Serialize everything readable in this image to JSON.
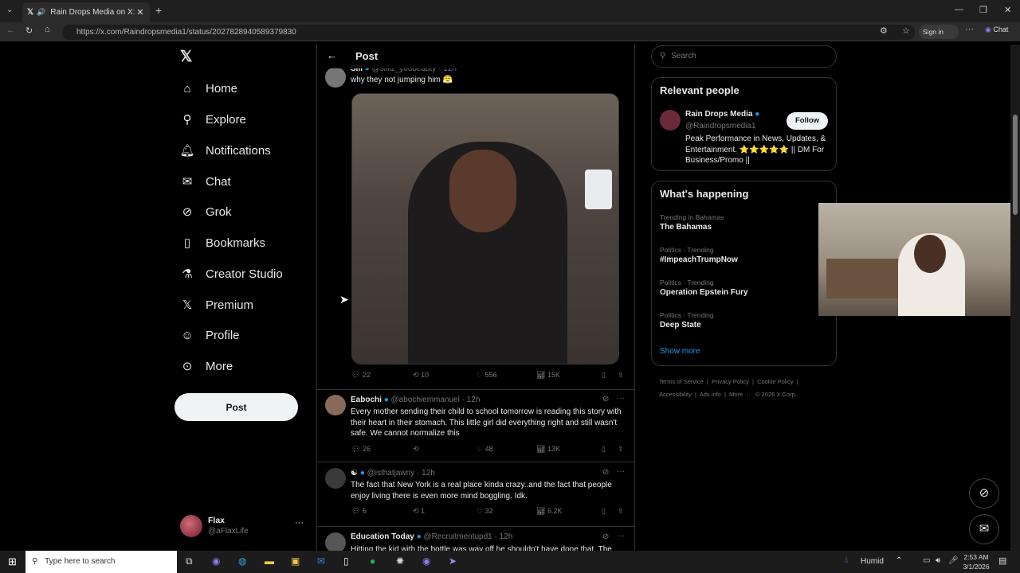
{
  "browser": {
    "tab_title": "Rain Drops Media on X: \"A m",
    "url": "https://x.com/Raindropsmedia1/status/2027828940589379830",
    "signin": "Sign in",
    "chat": "Chat"
  },
  "nav": {
    "items": [
      "Home",
      "Explore",
      "Notifications",
      "Chat",
      "Grok",
      "Bookmarks",
      "Creator Studio",
      "Premium",
      "Profile",
      "More"
    ],
    "post": "Post"
  },
  "account": {
    "name": "Flax",
    "handle": "@aFlaxLife"
  },
  "header": {
    "title": "Post"
  },
  "tweets": [
    {
      "name": "Sili",
      "handle": "@silliz_youbeauty",
      "time": "· 12h",
      "text": "why they not jumping him 😤",
      "replies": "22",
      "reposts": "10",
      "likes": "556",
      "views": "15K"
    },
    {
      "name": "Eabochi",
      "handle": "@abochiemmanuel",
      "time": "· 12h",
      "text": "Every mother sending their child to school tomorrow is reading this story with their heart in their stomach. This little girl did everything right and still wasn't safe. We cannot normalize this",
      "replies": "26",
      "reposts": "",
      "likes": "48",
      "views": "13K"
    },
    {
      "name": "",
      "handle": "@isthatjawny",
      "time": "· 12h",
      "text": "The fact that New York is a real place kinda crazy..and the fact that people enjoy living there is even more mind boggling. Idk.",
      "replies": "6",
      "reposts": "1",
      "likes": "32",
      "views": "6.2K"
    },
    {
      "name": "Education Today",
      "handle": "@Recruitmentupd1",
      "time": "· 12h",
      "text": "Hitting the kid with the bottle was way off he shouldn't have done that. The"
    }
  ],
  "search": {
    "placeholder": "Search"
  },
  "relevant": {
    "title": "Relevant people",
    "name": "Rain Drops Media",
    "handle": "@Raindropsmedia1",
    "follow": "Follow",
    "bio": "Peak Performance in News, Updates, & Entertainment. ⭐⭐⭐⭐⭐ || DM For Business/Promo ||"
  },
  "happening": {
    "title": "What's happening",
    "trends": [
      {
        "cat": "Trending in Bahamas",
        "name": "The Bahamas"
      },
      {
        "cat": "Politics · Trending",
        "name": "#ImpeachTrumpNow"
      },
      {
        "cat": "Politics · Trending",
        "name": "Operation Epstein Fury"
      },
      {
        "cat": "Politics · Trending",
        "name": "Deep State"
      }
    ],
    "show_more": "Show more"
  },
  "footer": {
    "links": [
      "Terms of Service",
      "Privacy Policy",
      "Cookie Policy",
      "Accessibility",
      "Ads info",
      "More ···",
      "© 2026 X Corp."
    ]
  },
  "taskbar": {
    "search": "Type here to search",
    "weather": "Humid",
    "time": "2:53 AM",
    "date": "3/1/2026"
  },
  "colors": {
    "accent": "#1d9bf0",
    "bg": "#000000",
    "border": "#2f3336",
    "muted": "#71767b"
  }
}
